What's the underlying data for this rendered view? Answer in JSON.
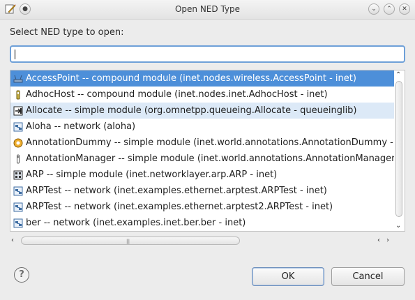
{
  "window": {
    "title": "Open NED Type"
  },
  "prompt": "Select NED type to open:",
  "search": {
    "value": "",
    "placeholder": ""
  },
  "list": {
    "items": [
      {
        "label": "AccessPoint -- compound module (inet.nodes.wireless.AccessPoint - inet)",
        "icon": "access-point-icon",
        "state": "selected"
      },
      {
        "label": "AdhocHost -- compound module (inet.nodes.inet.AdhocHost - inet)",
        "icon": "adhoc-host-icon",
        "state": ""
      },
      {
        "label": "Allocate -- simple module (org.omnetpp.queueing.Allocate - queueinglib)",
        "icon": "allocate-icon",
        "state": "hover"
      },
      {
        "label": "Aloha -- network (aloha)",
        "icon": "network-icon",
        "state": ""
      },
      {
        "label": "AnnotationDummy -- simple module (inet.world.annotations.AnnotationDummy - i",
        "icon": "annotation-dummy-icon",
        "state": ""
      },
      {
        "label": "AnnotationManager -- simple module (inet.world.annotations.AnnotationManager -",
        "icon": "annotation-manager-icon",
        "state": ""
      },
      {
        "label": "ARP -- simple module (inet.networklayer.arp.ARP - inet)",
        "icon": "arp-module-icon",
        "state": ""
      },
      {
        "label": "ARPTest -- network (inet.examples.ethernet.arptest.ARPTest - inet)",
        "icon": "network-icon",
        "state": ""
      },
      {
        "label": "ARPTest -- network (inet.examples.ethernet.arptest2.ARPTest - inet)",
        "icon": "network-icon",
        "state": ""
      },
      {
        "label": "ber -- network (inet.examples.inet.ber.ber - inet)",
        "icon": "network-icon",
        "state": ""
      }
    ]
  },
  "buttons": {
    "ok": "OK",
    "cancel": "Cancel",
    "help": "?"
  }
}
